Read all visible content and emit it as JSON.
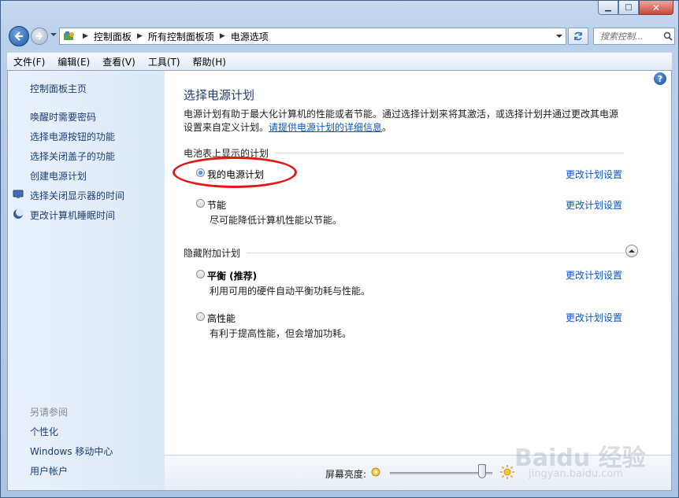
{
  "window": {
    "caption_buttons": [
      "minimize",
      "maximize",
      "close"
    ]
  },
  "navbar": {
    "breadcrumbs": [
      "控制面板",
      "所有控制面板项",
      "电源选项"
    ],
    "search_placeholder": "搜索控制..."
  },
  "menubar": {
    "items": [
      "文件(F)",
      "编辑(E)",
      "查看(V)",
      "工具(T)",
      "帮助(H)"
    ]
  },
  "sidebar": {
    "home": "控制面板主页",
    "links": [
      {
        "label": "唤醒时需要密码",
        "icon": ""
      },
      {
        "label": "选择电源按钮的功能",
        "icon": ""
      },
      {
        "label": "选择关闭盖子的功能",
        "icon": ""
      },
      {
        "label": "创建电源计划",
        "icon": ""
      },
      {
        "label": "选择关闭显示器的时间",
        "icon": "monitor-icon"
      },
      {
        "label": "更改计算机睡眠时间",
        "icon": "moon-icon"
      }
    ],
    "see_also": "另请参阅",
    "see_also_links": [
      "个性化",
      "Windows 移动中心",
      "用户帐户"
    ]
  },
  "main": {
    "title": "选择电源计划",
    "description": "电源计划有助于最大化计算机的性能或者节能。通过选择计划来将其激活，或选择计划并通过更改其电源设置来自定义计划。",
    "description_link": "请提供电源计划的详细信息",
    "group1_label": "电池表上显示的计划",
    "group2_label": "隐藏附加计划",
    "plans": [
      {
        "name": "我的电源计划",
        "desc": "",
        "selected": true,
        "change": "更改计划设置"
      },
      {
        "name": "节能",
        "desc": "尽可能降低计算机性能以节能。",
        "selected": false,
        "change": "更改计划设置"
      },
      {
        "name": "平衡 (推荐)",
        "desc": "利用可用的硬件自动平衡功耗与性能。",
        "selected": false,
        "change": "更改计划设置"
      },
      {
        "name": "高性能",
        "desc": "有利于提高性能，但会增加功耗。",
        "selected": false,
        "change": "更改计划设置"
      }
    ]
  },
  "bottombar": {
    "brightness_label": "屏幕亮度:",
    "brightness_level": 0.9
  },
  "watermark": {
    "text": "Baidu 经验",
    "sub": "jingyan.baidu.com"
  },
  "colors": {
    "link": "#0b57c0",
    "title": "#1e3f74",
    "annotation": "#e01818"
  }
}
